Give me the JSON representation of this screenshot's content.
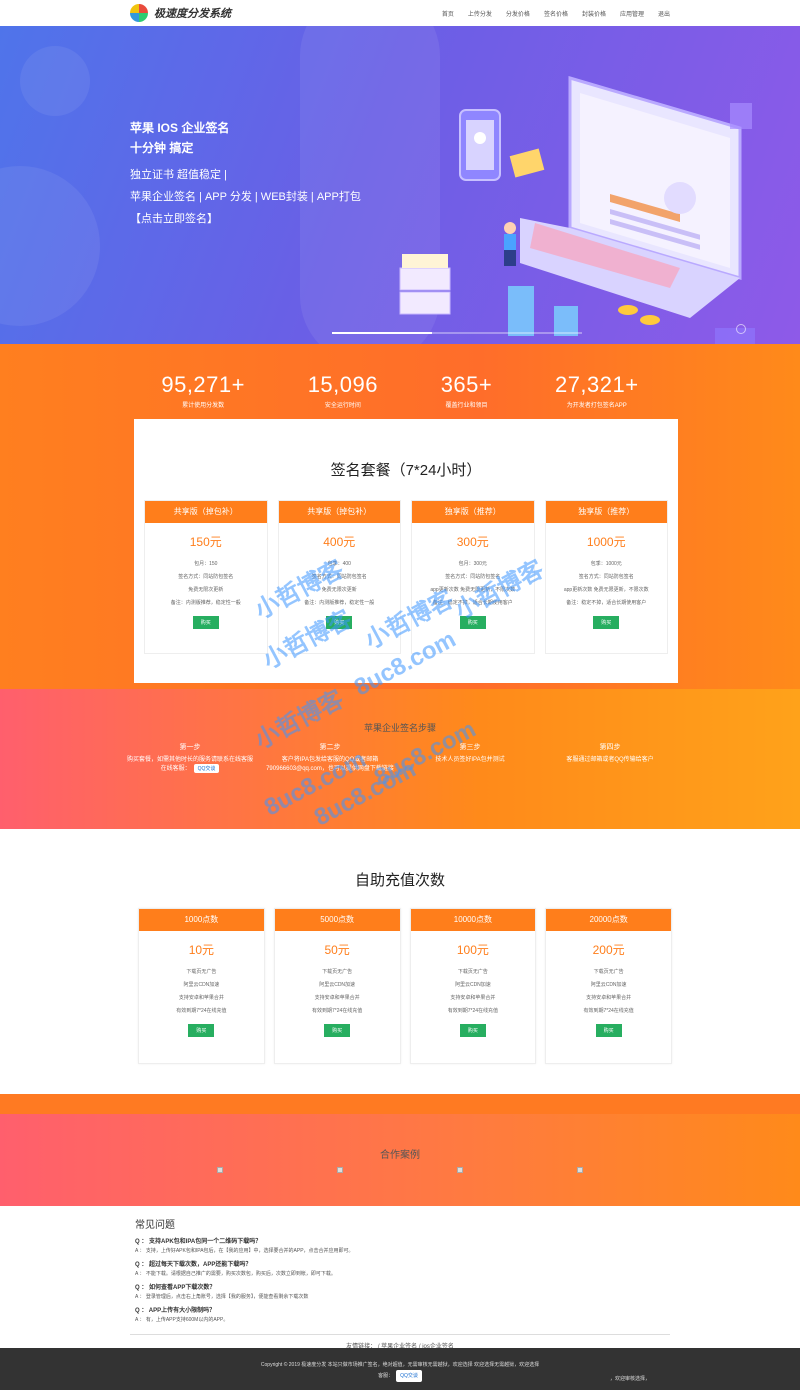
{
  "nav": {
    "logo_text": "极速度分发系统",
    "items": [
      "首页",
      "上传分发",
      "分发价格",
      "签名价格",
      "封装价格",
      "应用管理",
      "退出"
    ]
  },
  "hero": {
    "line1": "苹果 IOS 企业签名",
    "line2": "十分钟 搞定",
    "line3": "独立证书 超值稳定 |",
    "line4": "苹果企业签名 | APP 分发 | WEB封装 | APP打包",
    "cta": "【点击立即签名】"
  },
  "stats": [
    {
      "num": "95,271+",
      "label": "累计使用分发数"
    },
    {
      "num": "15,096",
      "label": "安全运行时间"
    },
    {
      "num": "365+",
      "label": "覆盖行业和领目"
    },
    {
      "num": "27,321+",
      "label": "为开发者打包签名APP"
    }
  ],
  "packages": {
    "title": "签名套餐（7*24小时）",
    "items": [
      {
        "name": "共享版（掉包补）",
        "price": "150元",
        "f1": "包月：150",
        "f2": "签名方式：同站防包签名",
        "f3": "免费无限次更新",
        "f4": "备注：内测版推荐，稳定性一般",
        "buy": "购买"
      },
      {
        "name": "共享版（掉包补）",
        "price": "400元",
        "f1": "包季：400",
        "f2": "签名方式：同站防包签名",
        "f3": "免费无限次更新",
        "f4": "备注：内测版推荐，稳定性一般",
        "buy": "购买"
      },
      {
        "name": "独享版（推荐）",
        "price": "300元",
        "f1": "包月：300元",
        "f2": "签名方式：同站防包签名",
        "f3": "app更新次数 免费无限更新，不限次数",
        "f4": "备注：稳定不掉，适合长期使用客户",
        "buy": "购买"
      },
      {
        "name": "独享版（推荐）",
        "price": "1000元",
        "f1": "包季：1000元",
        "f2": "签名方式：同站防包签名",
        "f3": "app更新次数 免费无限更新，不限次数",
        "f4": "备注：稳定不掉，适合长期使用客户",
        "buy": "购买"
      }
    ]
  },
  "steps": {
    "title": "苹果企业签名步骤",
    "items": [
      {
        "t": "第一步",
        "d": "购买套餐，如需其他时长的服务请联系在线客服",
        "extra": "在线客服："
      },
      {
        "t": "第二步",
        "d": "客户将IPA包发给客服的QQ或者邮箱790966603@qq.com，也可以提供网盘下载链接",
        "extra": ""
      },
      {
        "t": "第三步",
        "d": "技术人员签好IPA包并测试",
        "extra": ""
      },
      {
        "t": "第四步",
        "d": "客服通过邮箱或者QQ传输给客户",
        "extra": ""
      }
    ],
    "qq_label": "QQ交谈"
  },
  "recharge": {
    "title": "自助充值次数",
    "items": [
      {
        "name": "1000点数",
        "price": "10元",
        "f1": "下载页无广告",
        "f2": "阿里云CDN加速",
        "f3": "支持安卓和苹果合并",
        "f4": "有效到期7*24在线充值",
        "buy": "购买"
      },
      {
        "name": "5000点数",
        "price": "50元",
        "f1": "下载页无广告",
        "f2": "阿里云CDN加速",
        "f3": "支持安卓和苹果合并",
        "f4": "有效到期7*24在线充值",
        "buy": "购买"
      },
      {
        "name": "10000点数",
        "price": "100元",
        "f1": "下载页无广告",
        "f2": "阿里云CDN加速",
        "f3": "支持安卓和苹果合并",
        "f4": "有效到期7*24在线充值",
        "buy": "购买"
      },
      {
        "name": "20000点数",
        "price": "200元",
        "f1": "下载页无广告",
        "f2": "阿里云CDN加速",
        "f3": "支持安卓和苹果合并",
        "f4": "有效到期7*24在线充值",
        "buy": "购买"
      }
    ]
  },
  "cases": {
    "title": "合作案例"
  },
  "faq": {
    "title": "常见问题",
    "items": [
      {
        "q": "Q ： 支持APK包和IPA包同一个二维码下载吗？",
        "a": "A ： 支持，上传好APK包和IPA包后，在【我的应用】中，选择要合并的APP，点击合并应用即可。"
      },
      {
        "q": "Q ： 超过每天下载次数，APP还能下载吗？",
        "a": "A ： 不能下载。请根据自己推广的需要，购买次数包，购买后，次数立即到帐，即可下载。"
      },
      {
        "q": "Q ： 如何查看APP下载次数？",
        "a": "A ： 登录管理后，点击右上角账号，选择【我的服务】，便能查看剩余下载次数"
      },
      {
        "q": "Q ： APP上传有大小限制吗？",
        "a": "A ： 有，上传APP支持600M以内的APP。"
      }
    ]
  },
  "links": {
    "label": "友情链接：",
    "l1": "苹果企业签名",
    "l2": "ios企业签名"
  },
  "footer": {
    "line1": "Copyright © 2019 极速度分发    本站只做市场推广签名，绝对超值，无需审核无需越狱，欢迎选择    欢迎选择无需越狱，欢迎选择",
    "line2": "客服：",
    "qq": "QQ交谈",
    "right": "，欢迎审核选择，"
  },
  "watermark": {
    "t1": "小哲博客",
    "t2": "8uc8.com"
  }
}
